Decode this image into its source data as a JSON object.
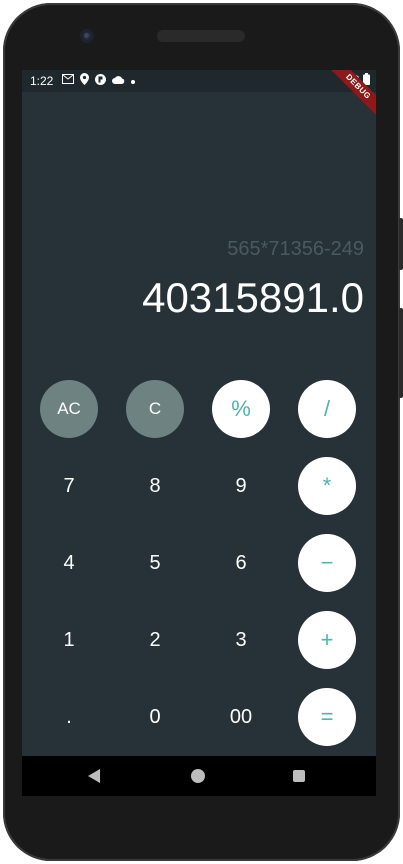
{
  "status_bar": {
    "time": "1:22",
    "left_icons": [
      "gmail-icon",
      "location-icon",
      "app-icon",
      "cloud-icon",
      "dot-icon"
    ],
    "right_icons": [
      "wifi-icon",
      "battery-icon"
    ]
  },
  "banner": {
    "debug_label": "DEBUG"
  },
  "display": {
    "expression": "565*71356-249",
    "result": "40315891.0"
  },
  "keys": {
    "ac": "AC",
    "c": "C",
    "percent": "%",
    "divide": "/",
    "seven": "7",
    "eight": "8",
    "nine": "9",
    "multiply": "*",
    "four": "4",
    "five": "5",
    "six": "6",
    "minus": "−",
    "one": "1",
    "two": "2",
    "three": "3",
    "plus": "+",
    "dot": ".",
    "zero": "0",
    "double_zero": "00",
    "equals": "="
  },
  "colors": {
    "background": "#263238",
    "gray_key": "#6e8282",
    "accent": "#4db6ac",
    "expression_text": "#4b5a5e"
  }
}
